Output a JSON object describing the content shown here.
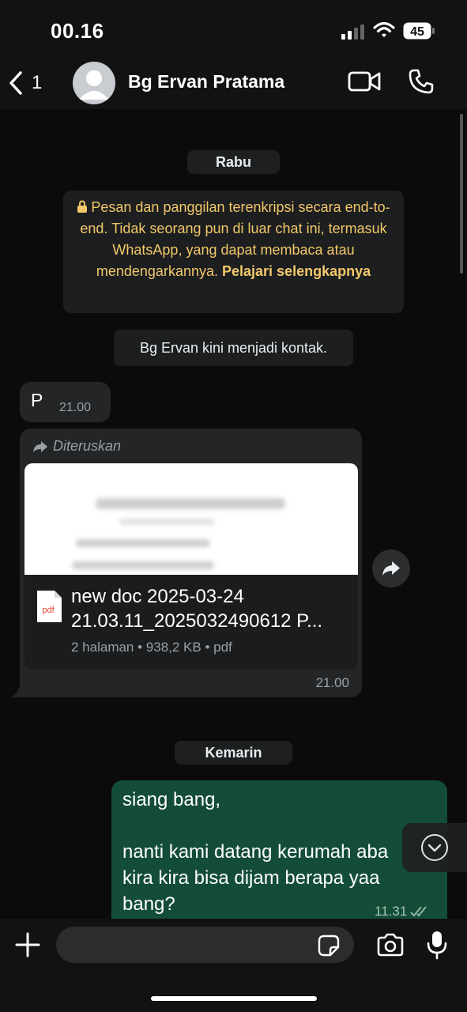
{
  "status_bar": {
    "time": "00.16",
    "battery": "45"
  },
  "header": {
    "back_count": "1",
    "contact_name": "Bg Ervan Pratama"
  },
  "chat": {
    "date_1": "Rabu",
    "encryption_notice": "Pesan dan panggilan terenkripsi secara end-to-end. Tidak seorang pun di luar chat ini, termasuk WhatsApp, yang dapat membaca atau mendengarkannya.",
    "encryption_link": "Pelajari selengkapnya",
    "system_message": "Bg Ervan kini menjadi kontak.",
    "message_1": {
      "text": "P",
      "time": "21.00"
    },
    "message_2": {
      "forwarded_label": "Diteruskan",
      "file_name_line1": "new doc 2025-03-24",
      "file_name_line2": "21.03.11_2025032490612 P...",
      "file_icon_label": "pdf",
      "file_meta": "2 halaman • 938,2 KB • pdf",
      "time": "21.00"
    },
    "date_2": "Kemarin",
    "message_3": {
      "line1": "siang bang,",
      "line2": "nanti kami datang kerumah aba",
      "line3": "kira kira bisa dijam berapa yaa",
      "line4": "bang?",
      "time": "11.31"
    }
  },
  "input": {
    "placeholder": ""
  },
  "colors": {
    "background": "#0b0b0b",
    "incoming_bubble": "#232526",
    "outgoing_bubble": "#144d37",
    "encryption_text": "#f3c86a"
  },
  "icons": [
    "back-chevron-icon",
    "avatar-icon",
    "video-call-icon",
    "phone-icon",
    "lock-icon",
    "forward-arrow-icon",
    "pdf-icon",
    "share-icon",
    "double-check-icon",
    "chevron-down-icon",
    "plus-icon",
    "sticker-icon",
    "camera-icon",
    "mic-icon"
  ]
}
